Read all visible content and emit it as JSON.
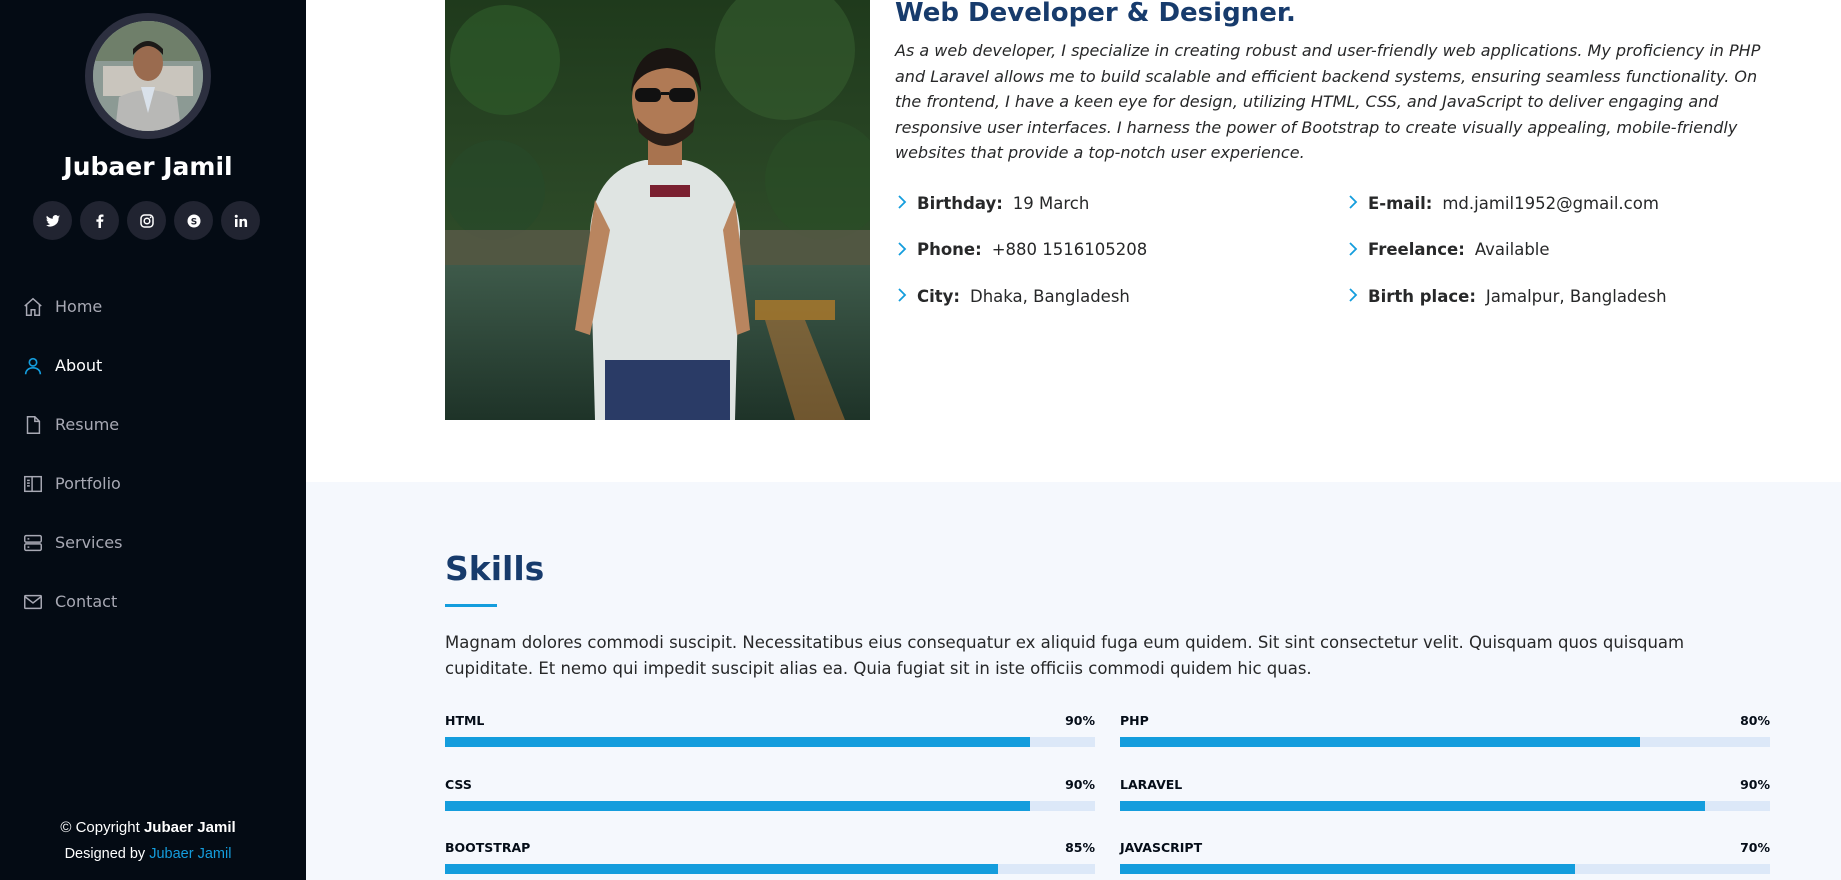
{
  "profile": {
    "name": "Jubaer Jamil",
    "social": [
      {
        "icon": "twitter-icon"
      },
      {
        "icon": "facebook-icon"
      },
      {
        "icon": "instagram-icon"
      },
      {
        "icon": "skype-icon"
      },
      {
        "icon": "linkedin-icon"
      }
    ]
  },
  "nav": {
    "items": [
      {
        "label": "Home",
        "icon": "home-icon",
        "active": false
      },
      {
        "label": "About",
        "icon": "person-icon",
        "active": true
      },
      {
        "label": "Resume",
        "icon": "file-icon",
        "active": false
      },
      {
        "label": "Portfolio",
        "icon": "book-icon",
        "active": false
      },
      {
        "label": "Services",
        "icon": "server-icon",
        "active": false
      },
      {
        "label": "Contact",
        "icon": "envelope-icon",
        "active": false
      }
    ]
  },
  "footer": {
    "copyright_prefix": "© Copyright",
    "copyright_name": "Jubaer Jamil",
    "designed_prefix": "Designed by",
    "designed_name": "Jubaer Jamil"
  },
  "about": {
    "title": "Web Developer & Designer.",
    "description": "As a web developer, I specialize in creating robust and user-friendly web applications. My proficiency in PHP and Laravel allows me to build scalable and efficient backend systems, ensuring seamless functionality. On the frontend, I have a keen eye for design, utilizing HTML, CSS, and JavaScript to deliver engaging and responsive user interfaces. I harness the power of Bootstrap to create visually appealing, mobile-friendly websites that provide a top-notch user experience.",
    "info_left": [
      {
        "label": "Birthday:",
        "value": "19 March"
      },
      {
        "label": "Phone:",
        "value": "+880 1516105208"
      },
      {
        "label": "City:",
        "value": "Dhaka, Bangladesh"
      }
    ],
    "info_right": [
      {
        "label": "E-mail:",
        "value": "md.jamil1952@gmail.com"
      },
      {
        "label": "Freelance:",
        "value": "Available"
      },
      {
        "label": "Birth place:",
        "value": "Jamalpur, Bangladesh"
      }
    ]
  },
  "skills": {
    "title": "Skills",
    "description": "Magnam dolores commodi suscipit. Necessitatibus eius consequatur ex aliquid fuga eum quidem. Sit sint consectetur velit. Quisquam quos quisquam cupiditate. Et nemo qui impedit suscipit alias ea. Quia fugiat sit in iste officiis commodi quidem hic quas.",
    "items": [
      {
        "name": "HTML",
        "percent_label": "90%",
        "value": 90
      },
      {
        "name": "PHP",
        "percent_label": "80%",
        "value": 80
      },
      {
        "name": "CSS",
        "percent_label": "90%",
        "value": 90
      },
      {
        "name": "LARAVEL",
        "percent_label": "90%",
        "value": 90
      },
      {
        "name": "BOOTSTRAP",
        "percent_label": "85%",
        "value": 85
      },
      {
        "name": "JAVASCRIPT",
        "percent_label": "70%",
        "value": 70
      }
    ]
  },
  "colors": {
    "accent": "#149ddd",
    "sidebar_bg": "#040b14",
    "heading": "#173b6c",
    "skills_bg": "#f5f8fd"
  }
}
